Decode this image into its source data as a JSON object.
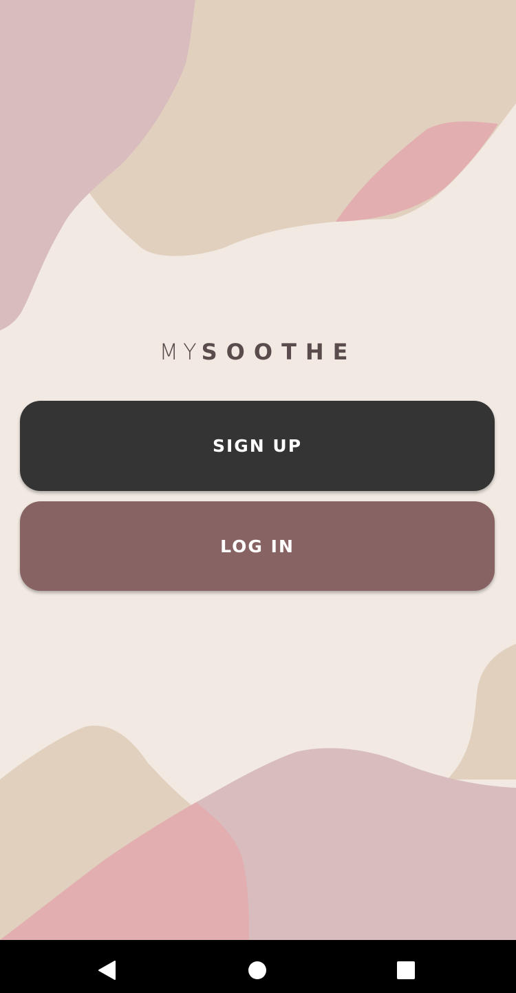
{
  "app": {
    "logo_light": "MY",
    "logo_bold": "SOOTHE"
  },
  "actions": {
    "signup_label": "SIGN UP",
    "login_label": "LOG IN"
  },
  "colors": {
    "background": "#f1e9e2",
    "signup_button": "#343434",
    "login_button": "#886363",
    "logo_text": "#5a4c4c",
    "shape_mauve": "#d8bcbe",
    "shape_beige": "#e2d0bf",
    "shape_pink": "#e2aeb0"
  },
  "system_nav": {
    "back_icon": "triangle-back-icon",
    "home_icon": "circle-home-icon",
    "recents_icon": "square-recents-icon"
  }
}
